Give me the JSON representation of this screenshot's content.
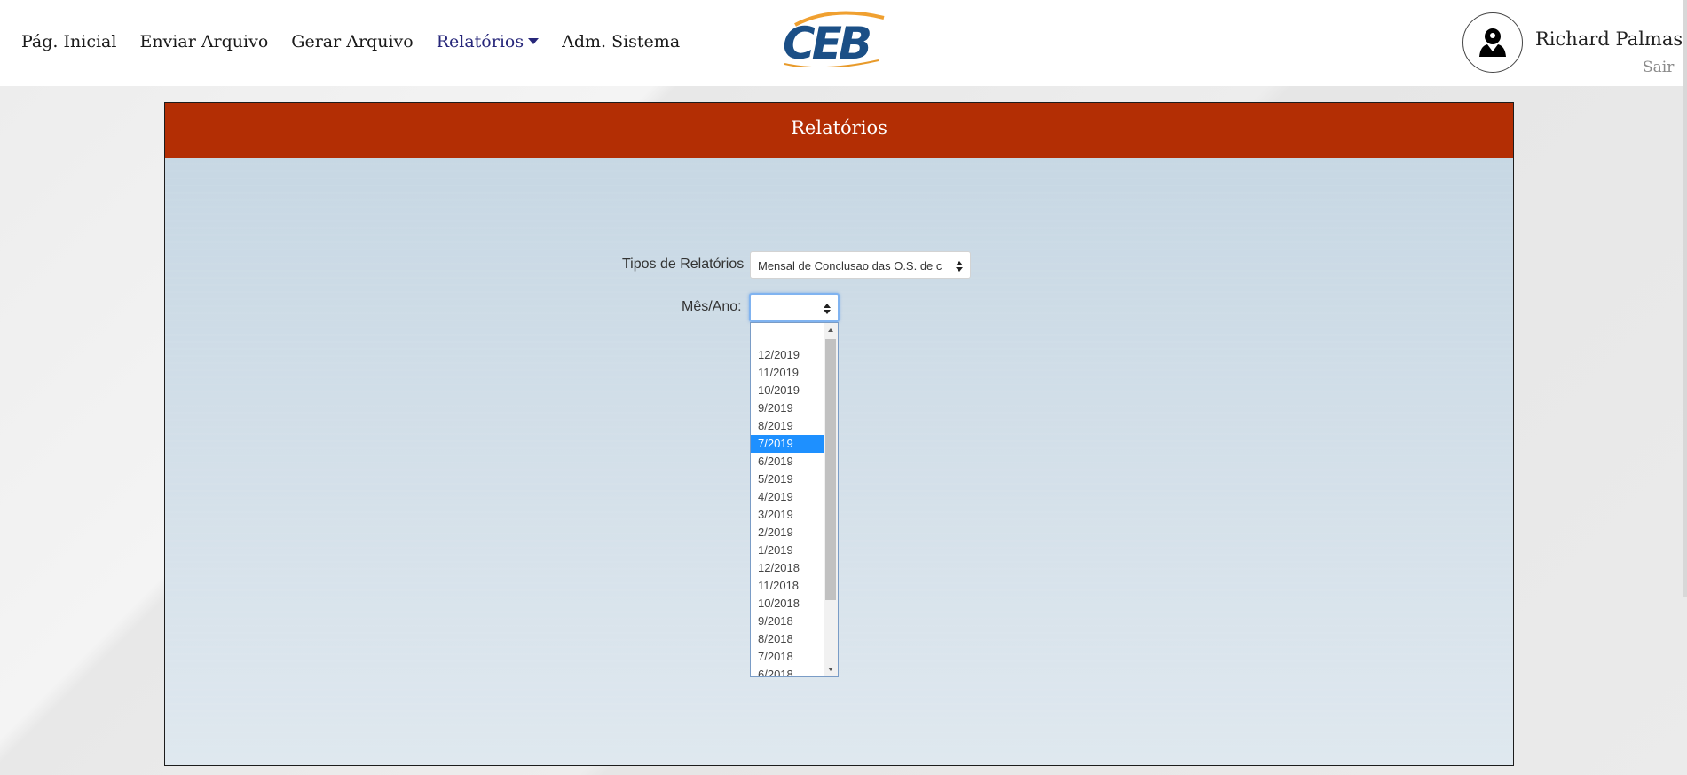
{
  "nav": {
    "items": [
      {
        "label": "Pág. Inicial"
      },
      {
        "label": "Enviar Arquivo"
      },
      {
        "label": "Gerar Arquivo"
      },
      {
        "label": "Relatórios"
      },
      {
        "label": "Adm. Sistema"
      }
    ],
    "active_index": 3
  },
  "logo": {
    "text": "CEB",
    "colors": {
      "primary": "#1b4f86",
      "swoosh": "#f0a030"
    }
  },
  "user": {
    "name": "Richard Palmas",
    "logout_label": "Sair",
    "icon": "user-icon"
  },
  "panel": {
    "title": "Relatórios",
    "header_color": "#b32e04"
  },
  "form": {
    "report_type_label": "Tipos de Relatórios",
    "report_type_value": "Mensal de Conclusao das O.S. de c",
    "month_year_label": "Mês/Ano:",
    "month_year_value": ""
  },
  "dropdown": {
    "options": [
      "",
      "12/2019",
      "11/2019",
      "10/2019",
      "9/2019",
      "8/2019",
      "7/2019",
      "6/2019",
      "5/2019",
      "4/2019",
      "3/2019",
      "2/2019",
      "1/2019",
      "12/2018",
      "11/2018",
      "10/2018",
      "9/2018",
      "8/2018",
      "7/2018",
      "6/2018"
    ],
    "highlighted": "7/2019"
  }
}
